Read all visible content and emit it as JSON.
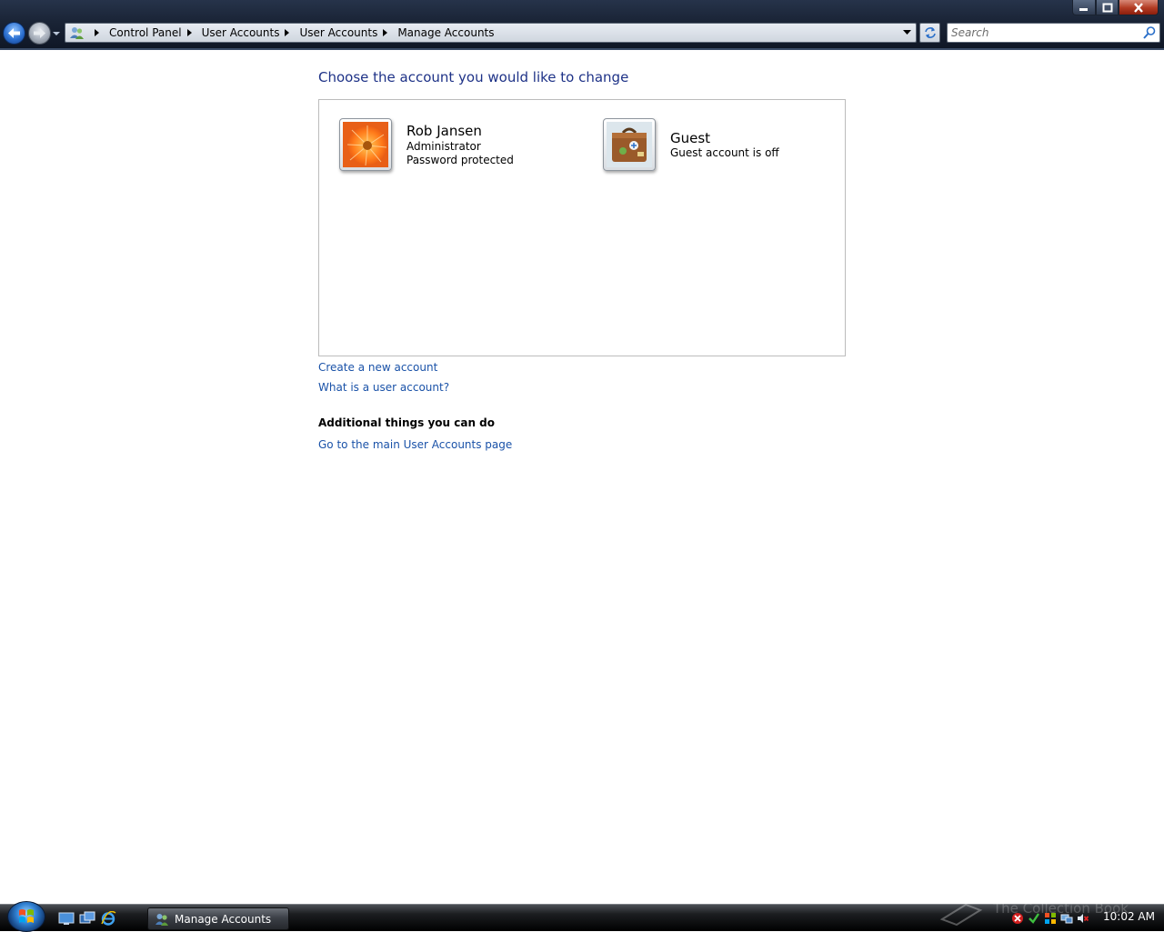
{
  "window": {
    "breadcrumb": [
      "Control Panel",
      "User Accounts",
      "User Accounts",
      "Manage Accounts"
    ],
    "search_placeholder": "Search"
  },
  "content": {
    "title": "Choose the account you would like to change",
    "accounts": [
      {
        "name": "Rob Jansen",
        "role": "Administrator",
        "status": "Password protected",
        "avatar": "orange-flower-picture"
      },
      {
        "name": "Guest",
        "status": "Guest account is off",
        "avatar": "suitcase-picture"
      }
    ],
    "links": {
      "create": "Create a new account",
      "what": "What is a user account?"
    },
    "additional": {
      "heading": "Additional things you can do",
      "main_page": "Go to the main User Accounts page"
    }
  },
  "taskbar": {
    "task_label": "Manage Accounts",
    "clock": "10:02 AM",
    "watermark": "The Collection Book"
  },
  "colors": {
    "title_blue": "#1e3287",
    "link_blue": "#1a52a8"
  }
}
